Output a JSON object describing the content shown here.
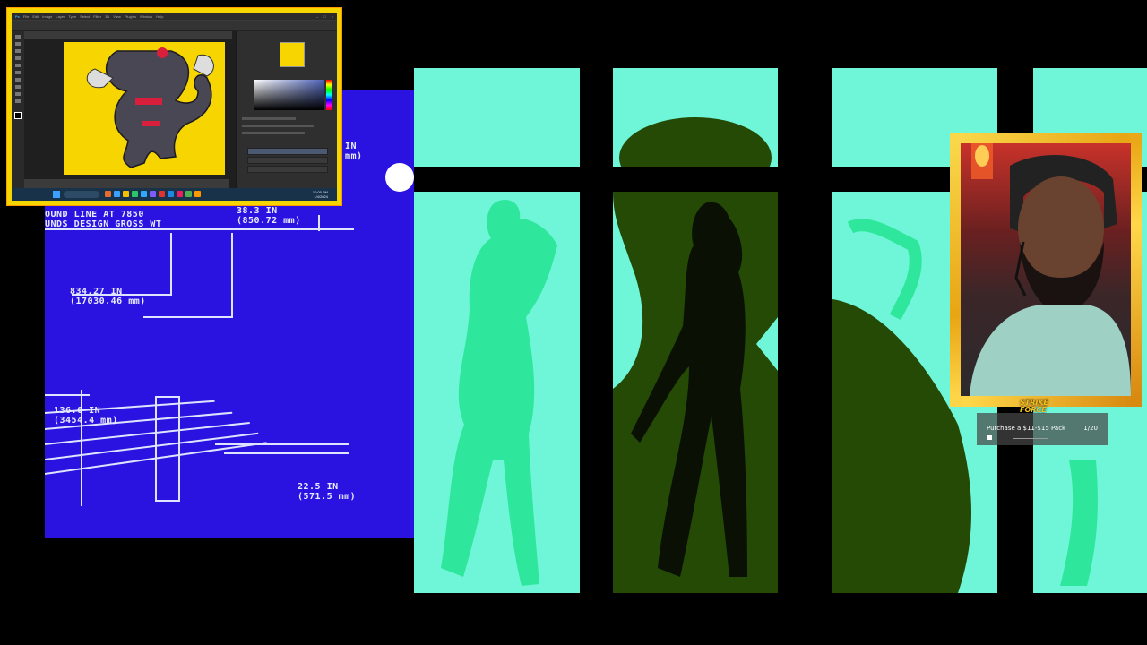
{
  "blueprint": {
    "labels": [
      "OUND LINE AT 7850\nUNDS DESIGN GROSS WT",
      "38.3 IN\n(850.72 mm)",
      "834.27 IN\n(17030.46 mm)",
      "136.0 IN\n(3454.4 mm)",
      "22.5 IN\n(571.5 mm)",
      "IN\nmm)"
    ]
  },
  "photoshop": {
    "menus": [
      "File",
      "Edit",
      "Image",
      "Layer",
      "Type",
      "Select",
      "Filter",
      "3D",
      "View",
      "Plugins",
      "Window",
      "Help"
    ],
    "clock": {
      "time": "10:05 PM",
      "date": "1/4/2024"
    }
  },
  "quest": {
    "label": "Purchase a $11-$15 Pack",
    "count": "1/20"
  },
  "logo": {
    "text": "STRIKE FORCE"
  },
  "colors": {
    "blueprint": "#2a12e0",
    "window_glass": "#6ff6d8",
    "frame_yellow": "#f6d600",
    "silhouette_green": "#244a06"
  }
}
